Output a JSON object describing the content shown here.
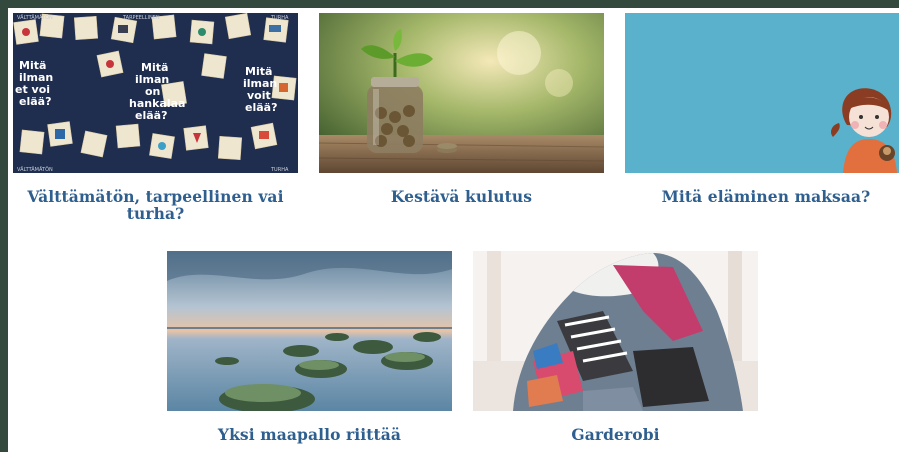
{
  "cards": [
    {
      "title": "Välttämätön, tarpeellinen vai turha?",
      "image_text": [
        "Mitä ilman et voi elää?",
        "Mitä ilman on hankalaa elää?",
        "Mitä ilman voit elää?"
      ],
      "image_labels": [
        "VÄLTTÄMÄTÖN",
        "TARPEELLINEN",
        "TURHA"
      ]
    },
    {
      "title": "Kestävä kulutus"
    },
    {
      "title": "Mitä eläminen maksaa?"
    },
    {
      "title": "Yksi maapallo riittää"
    },
    {
      "title": "Garderobi"
    }
  ],
  "colors": {
    "frame": "#33493d",
    "link": "#2e5f8f",
    "teal": "#5ab1cb"
  }
}
